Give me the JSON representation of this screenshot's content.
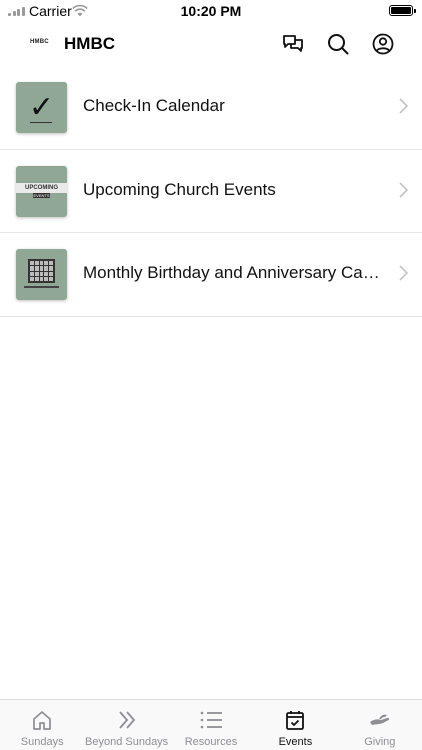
{
  "status_bar": {
    "carrier": "Carrier",
    "time": "10:20 PM"
  },
  "header": {
    "logo_text": "HMBC",
    "title": "HMBC",
    "icons": [
      "chat-icon",
      "search-icon",
      "profile-icon"
    ]
  },
  "list": {
    "items": [
      {
        "label": "Check-In Calendar",
        "thumb": "checkmark"
      },
      {
        "label": "Upcoming Church Events",
        "thumb": "upcoming-banner",
        "thumb_text": "UPCOMING",
        "thumb_subtext": "EVENTS"
      },
      {
        "label": "Monthly Birthday and Anniversary Calendar",
        "thumb": "calendar-grid"
      }
    ]
  },
  "tabbar": {
    "active": "Events",
    "tabs": [
      {
        "label": "Sundays",
        "icon": "home-icon"
      },
      {
        "label": "Beyond Sundays",
        "icon": "double-chevron-icon"
      },
      {
        "label": "Resources",
        "icon": "list-icon"
      },
      {
        "label": "Events",
        "icon": "calendar-check-icon"
      },
      {
        "label": "Giving",
        "icon": "hand-icon"
      }
    ]
  },
  "colors": {
    "thumb_bg": "#8fa794",
    "tab_inactive": "#8e8e93",
    "tab_active": "#111111",
    "divider": "#e6e6e6"
  }
}
